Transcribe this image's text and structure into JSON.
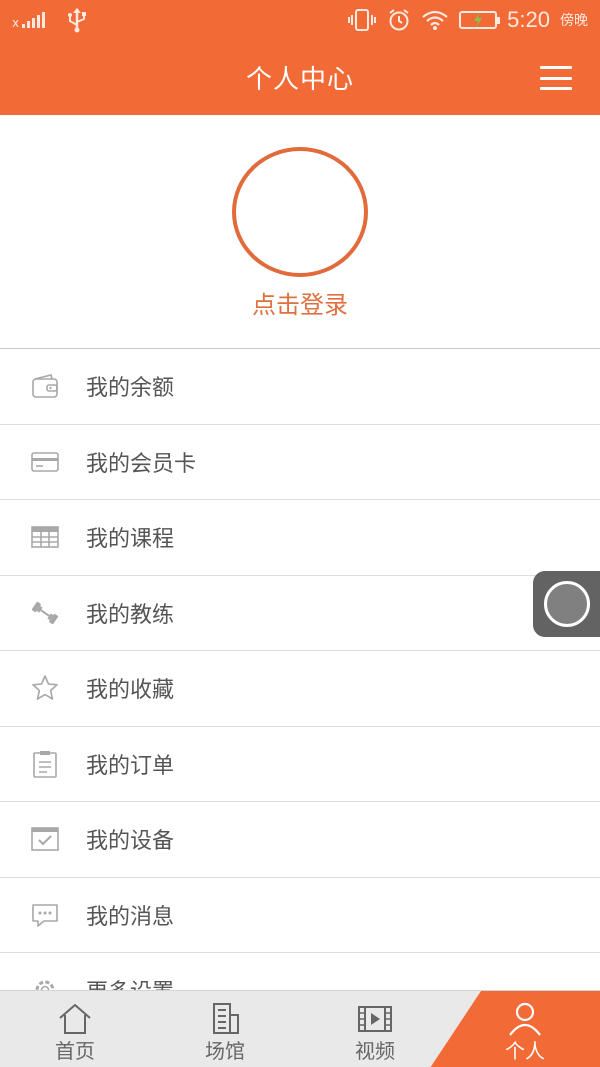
{
  "status_bar": {
    "time": "5:20",
    "period": "傍晚",
    "battery_icon": "battery-charging-icon"
  },
  "header": {
    "title": "个人中心",
    "menu_icon": "hamburger-menu-icon"
  },
  "profile": {
    "login_label": "点击登录"
  },
  "menu": {
    "items": [
      {
        "label": "我的余额",
        "icon": "wallet-icon"
      },
      {
        "label": "我的会员卡",
        "icon": "card-icon"
      },
      {
        "label": "我的课程",
        "icon": "table-icon"
      },
      {
        "label": "我的教练",
        "icon": "dumbbell-icon"
      },
      {
        "label": "我的收藏",
        "icon": "star-icon"
      },
      {
        "label": "我的订单",
        "icon": "clipboard-icon"
      },
      {
        "label": "我的设备",
        "icon": "device-check-icon"
      },
      {
        "label": "我的消息",
        "icon": "message-icon"
      },
      {
        "label": "更多设置",
        "icon": "gear-icon"
      }
    ]
  },
  "bottom_nav": {
    "tabs": [
      {
        "label": "首页",
        "icon": "home-icon"
      },
      {
        "label": "场馆",
        "icon": "building-icon"
      },
      {
        "label": "视频",
        "icon": "film-icon"
      },
      {
        "label": "个人",
        "icon": "person-icon"
      }
    ],
    "active_index": 3
  },
  "colors": {
    "accent": "#f26a36",
    "avatar_border": "#e26b3c",
    "text": "#555555",
    "nav_bg": "#e9e9e9"
  }
}
